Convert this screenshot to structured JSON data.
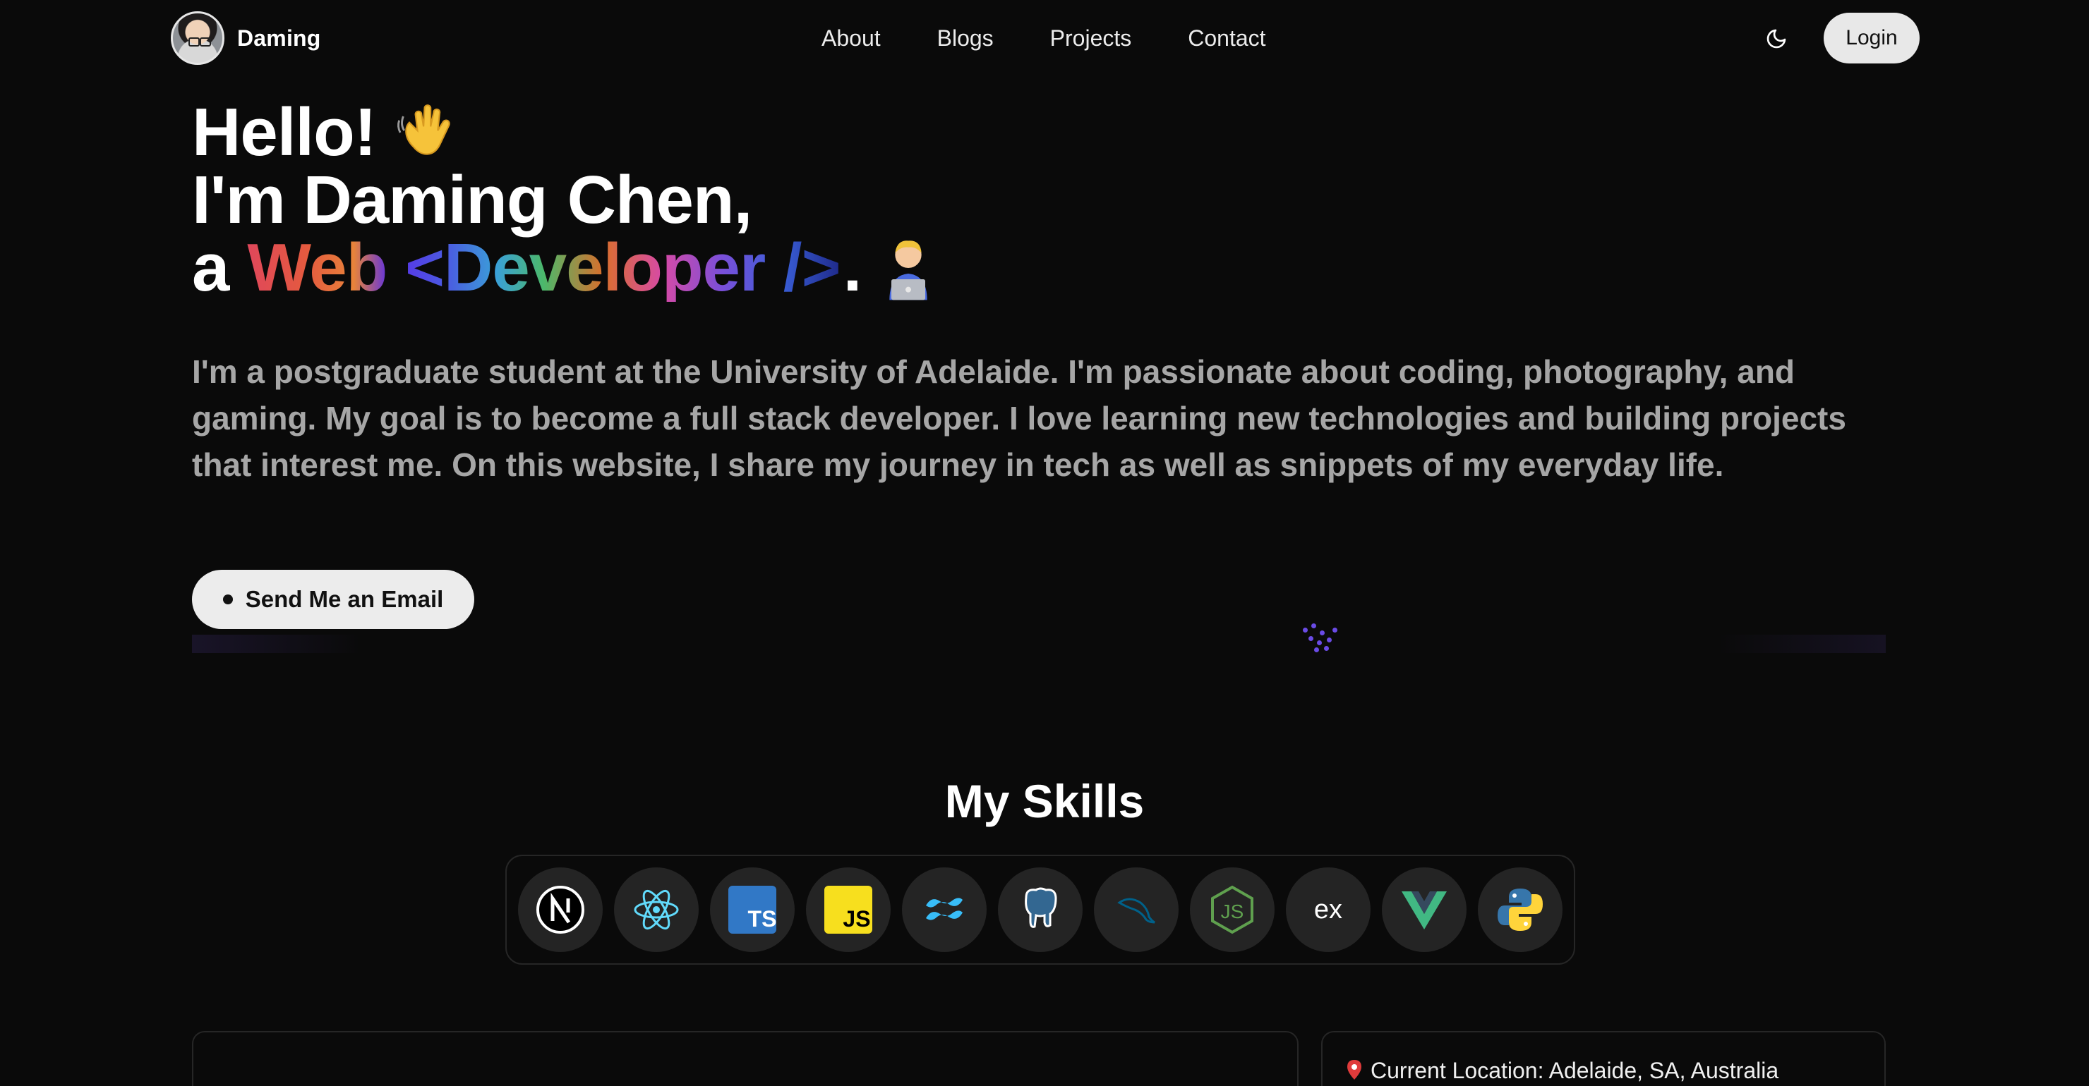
{
  "header": {
    "brand_name": "Daming",
    "nav": [
      "About",
      "Blogs",
      "Projects",
      "Contact"
    ],
    "login_label": "Login"
  },
  "hero": {
    "line1": "Hello!",
    "line2_a": "I'm Daming",
    "line2_b": "Chen,",
    "line3_prefix": "a",
    "line3_role": "Web <Developer />",
    "line3_suffix": ".",
    "icons": [
      "waving-hand-icon",
      "technologist-icon"
    ]
  },
  "bio": "I'm a postgraduate student at the University of Adelaide. I'm passionate about coding, photography, and gaming. My goal is to become a full stack developer. I love learning new technologies and building projects that interest me. On this website, I share my journey in tech as well as snippets of my everyday life.",
  "email_button": "Send Me an Email",
  "skills": {
    "title": "My Skills",
    "icons": [
      "nextjs-icon",
      "react-icon",
      "typescript-icon",
      "javascript-icon",
      "tailwind-icon",
      "postgresql-icon",
      "mysql-icon",
      "nodejs-icon",
      "express-icon",
      "vue-icon",
      "python-icon"
    ]
  },
  "location": {
    "label": "Current Location: Adelaide, SA, Australia"
  },
  "colors": {
    "background": "#0a0a0a",
    "bio_text": "#a6a6a6",
    "button_bg": "#ececec",
    "card_border": "#262626"
  }
}
